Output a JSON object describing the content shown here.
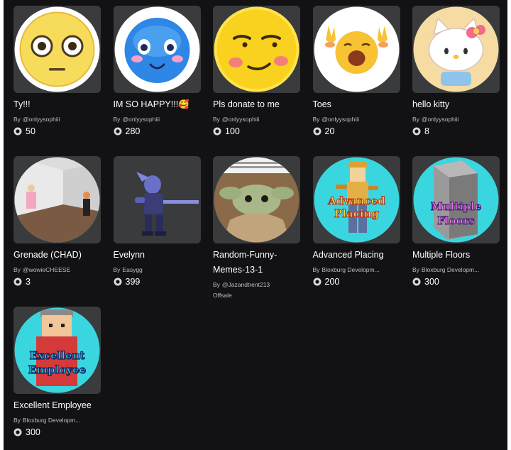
{
  "items": [
    {
      "name": "Ty!!!",
      "by": "By",
      "creator": "@onlyysophiii",
      "price": "50",
      "icon": "flushed-emoji-icon"
    },
    {
      "name": "IM SO HAPPY!!!🥰",
      "by": "By",
      "creator": "@onlyysophiii",
      "price": "280",
      "icon": "blue-smiling-emoji-icon"
    },
    {
      "name": "Pls donate to me",
      "by": "By",
      "creator": "@onlyysophiii",
      "price": "100",
      "icon": "smirking-emoji-icon"
    },
    {
      "name": "Toes",
      "by": "By",
      "creator": "@onlyysophiii",
      "price": "20",
      "icon": "crying-emoji-icon"
    },
    {
      "name": "hello kitty",
      "by": "By",
      "creator": "@onlyysophiii",
      "price": "8",
      "icon": "hello-kitty-icon"
    },
    {
      "name": "Grenade (CHAD)",
      "by": "By",
      "creator": "@wowieCHEESE",
      "price": "3",
      "icon": "room-scene-icon"
    },
    {
      "name": "Evelynn",
      "by": "By",
      "creator": "Easygg",
      "price": "399",
      "icon": "armored-character-icon"
    },
    {
      "name": "Random-Funny-Memes-13-1",
      "by": "By",
      "creator": "@Jazandtrent213",
      "offsale": "Offsale",
      "icon": "meme-photo-icon"
    },
    {
      "name": "Advanced Placing",
      "by": "By",
      "creator": "Bloxburg Developm...",
      "price": "200",
      "icon": "advanced-placing-icon",
      "badge_text": [
        "Advanced",
        "Placing"
      ]
    },
    {
      "name": "Multiple Floors",
      "by": "By",
      "creator": "Bloxburg Developm...",
      "price": "300",
      "icon": "multiple-floors-icon",
      "badge_text": [
        "Multiple",
        "Floors"
      ]
    },
    {
      "name": "Excellent Employee",
      "by": "By",
      "creator": "Bloxburg Developm...",
      "price": "300",
      "icon": "excellent-employee-icon",
      "badge_text": [
        "Excellent",
        "Employee"
      ]
    }
  ],
  "colors": {
    "background": "#121215",
    "thumb_bg": "#393b3d",
    "text": "#ffffff",
    "muted": "#bdbebe"
  }
}
